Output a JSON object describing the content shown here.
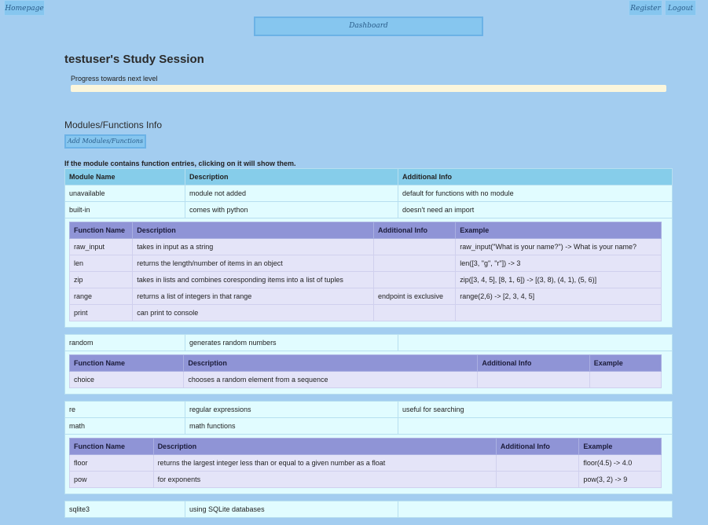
{
  "nav": {
    "homepage": "Homepage",
    "register": "Register",
    "logout": "Logout",
    "dashboard": "Dashboard"
  },
  "session": {
    "title": "testuser's Study Session",
    "progress_label": "Progress towards next level",
    "progress": 0
  },
  "modules_section": {
    "title": "Modules/Functions Info",
    "add_button": "Add Modules/Functions",
    "hint": "If the module contains function entries, clicking on it will show them.",
    "columns": [
      "Module Name",
      "Description",
      "Additional Info"
    ],
    "function_columns": [
      "Function Name",
      "Description",
      "Additional Info",
      "Example"
    ],
    "modules": [
      {
        "name": "unavailable",
        "description": "module not added",
        "info": "default for functions with no module",
        "functions": []
      },
      {
        "name": "built-in",
        "description": "comes with python",
        "info": "doesn't need an import",
        "functions": [
          {
            "name": "raw_input",
            "description": "takes in input as a string",
            "info": "",
            "example": "raw_input(\"What is your name?\") -> What is your name?"
          },
          {
            "name": "len",
            "description": "returns the length/number of items in an object",
            "info": "",
            "example": "len([3, \"g\", \"r\"]) -> 3"
          },
          {
            "name": "zip",
            "description": "takes in lists and combines coresponding items into a list of tuples",
            "info": "",
            "example": "zip([3, 4, 5], [8, 1, 6]) -> [(3, 8), (4, 1), (5, 6)]"
          },
          {
            "name": "range",
            "description": "returns a list of integers in that range",
            "info": "endpoint is exclusive",
            "example": "range(2,6) -> [2, 3, 4, 5]"
          },
          {
            "name": "print",
            "description": "can print to console",
            "info": "",
            "example": ""
          }
        ]
      },
      {
        "name": "random",
        "description": "generates random numbers",
        "info": "",
        "functions": [
          {
            "name": "choice",
            "description": "chooses a random element from a sequence",
            "info": "",
            "example": ""
          }
        ]
      },
      {
        "name": "re",
        "description": "regular expressions",
        "info": "useful for searching",
        "functions": []
      },
      {
        "name": "math",
        "description": "math functions",
        "info": "",
        "functions": [
          {
            "name": "floor",
            "description": "returns the largest integer less than or equal to a given number as a float",
            "info": "",
            "example": "floor(4.5) -> 4.0"
          },
          {
            "name": "pow",
            "description": "for exponents",
            "info": "",
            "example": "pow(3, 2) -> 9"
          }
        ]
      },
      {
        "name": "sqlite3",
        "description": "using SQLite databases",
        "info": "",
        "functions": []
      }
    ]
  }
}
